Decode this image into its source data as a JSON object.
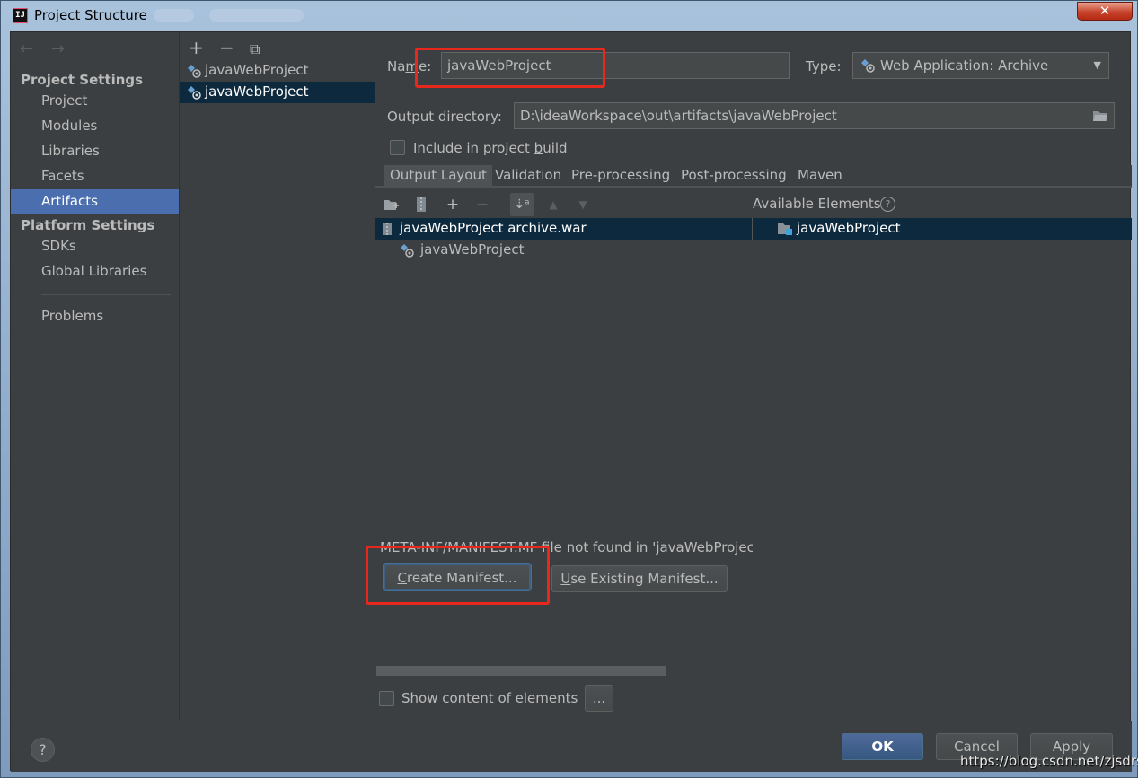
{
  "window": {
    "title": "Project Structure",
    "close_label": "✕",
    "app_icon_label": "IJ"
  },
  "nav": {
    "back_icon": "←",
    "forward_icon": "→",
    "project_settings_header": "Project Settings",
    "project_items": [
      "Project",
      "Modules",
      "Libraries",
      "Facets",
      "Artifacts"
    ],
    "platform_settings_header": "Platform Settings",
    "platform_items": [
      "SDKs",
      "Global Libraries"
    ],
    "problems_label": "Problems",
    "selected": "Artifacts"
  },
  "artifacts_list": {
    "toolbar": {
      "add": "+",
      "remove": "−",
      "copy": "⧉"
    },
    "items": [
      "javaWebProject",
      "javaWebProject"
    ],
    "selected_index": 1
  },
  "editor": {
    "name_label_pre": "Na",
    "name_label_mnemonic": "m",
    "name_label_post": "e:",
    "name_value": "javaWebProject",
    "type_label": "Type:",
    "type_value": "Web Application: Archive",
    "output_dir_label": "Output directory:",
    "output_dir_value": "D:\\ideaWorkspace\\out\\artifacts\\javaWebProject",
    "include_build_pre": "Include in project ",
    "include_build_mnemonic": "b",
    "include_build_post": "uild",
    "include_build_checked": false,
    "tabs": [
      "Output Layout",
      "Validation",
      "Pre-processing",
      "Post-processing",
      "Maven"
    ],
    "selected_tab": "Output Layout",
    "available_elements_label": "Available Elements",
    "layout_tree": [
      {
        "label": "javaWebProject archive.war",
        "icon": "war-archive-icon",
        "selected": true
      },
      {
        "label": "javaWebProject",
        "icon": "module-artifact-icon",
        "selected": false
      }
    ],
    "available_tree": [
      {
        "label": "javaWebProject",
        "icon": "folder-icon",
        "selected": true
      }
    ],
    "manifest_message": "META-INF/MANIFEST.MF file not found in 'javaWebProjec",
    "create_manifest_pre": "",
    "create_manifest_mnemonic": "C",
    "create_manifest_post": "reate Manifest...",
    "use_manifest_pre": "",
    "use_manifest_mnemonic": "U",
    "use_manifest_post": "se Existing Manifest...",
    "show_content_label": "Show content of elements",
    "show_content_checked": false,
    "more_button": "..."
  },
  "footer": {
    "help": "?",
    "ok": "OK",
    "cancel": "Cancel",
    "apply": "Apply"
  },
  "watermark": "https://blog.csdn.net/zjsdrs",
  "colors": {
    "background": "#3c3f41",
    "selection": "#4b6eaf",
    "tree_selection": "#0d293e",
    "highlight_box": "#e8281c",
    "text": "#bbbbbb"
  }
}
